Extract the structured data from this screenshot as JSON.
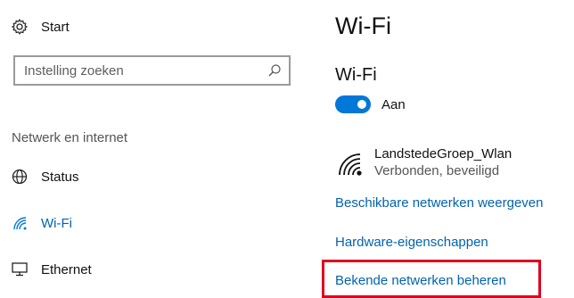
{
  "sidebar": {
    "home": {
      "label": "Start",
      "icon": "gear-icon"
    },
    "search": {
      "placeholder": "Instelling zoeken",
      "value": "",
      "icon": "search-icon"
    },
    "section_title": "Netwerk en internet",
    "items": [
      {
        "label": "Status",
        "icon": "globe-icon",
        "active": false
      },
      {
        "label": "Wi-Fi",
        "icon": "wifi-icon",
        "active": true
      },
      {
        "label": "Ethernet",
        "icon": "monitor-icon",
        "active": false
      }
    ]
  },
  "main": {
    "page_title": "Wi-Fi",
    "section_title": "Wi-Fi",
    "toggle": {
      "state_label": "Aan",
      "on": true
    },
    "network": {
      "name": "LandstedeGroep_Wlan",
      "status": "Verbonden, beveiligd",
      "icon": "wifi-secured-icon"
    },
    "links": [
      "Beschikbare netwerken weergeven",
      "Hardware-eigenschappen",
      "Bekende netwerken beheren"
    ]
  },
  "colors": {
    "accent": "#0078d7",
    "link": "#0063b1",
    "highlight_border": "#e0001b"
  }
}
